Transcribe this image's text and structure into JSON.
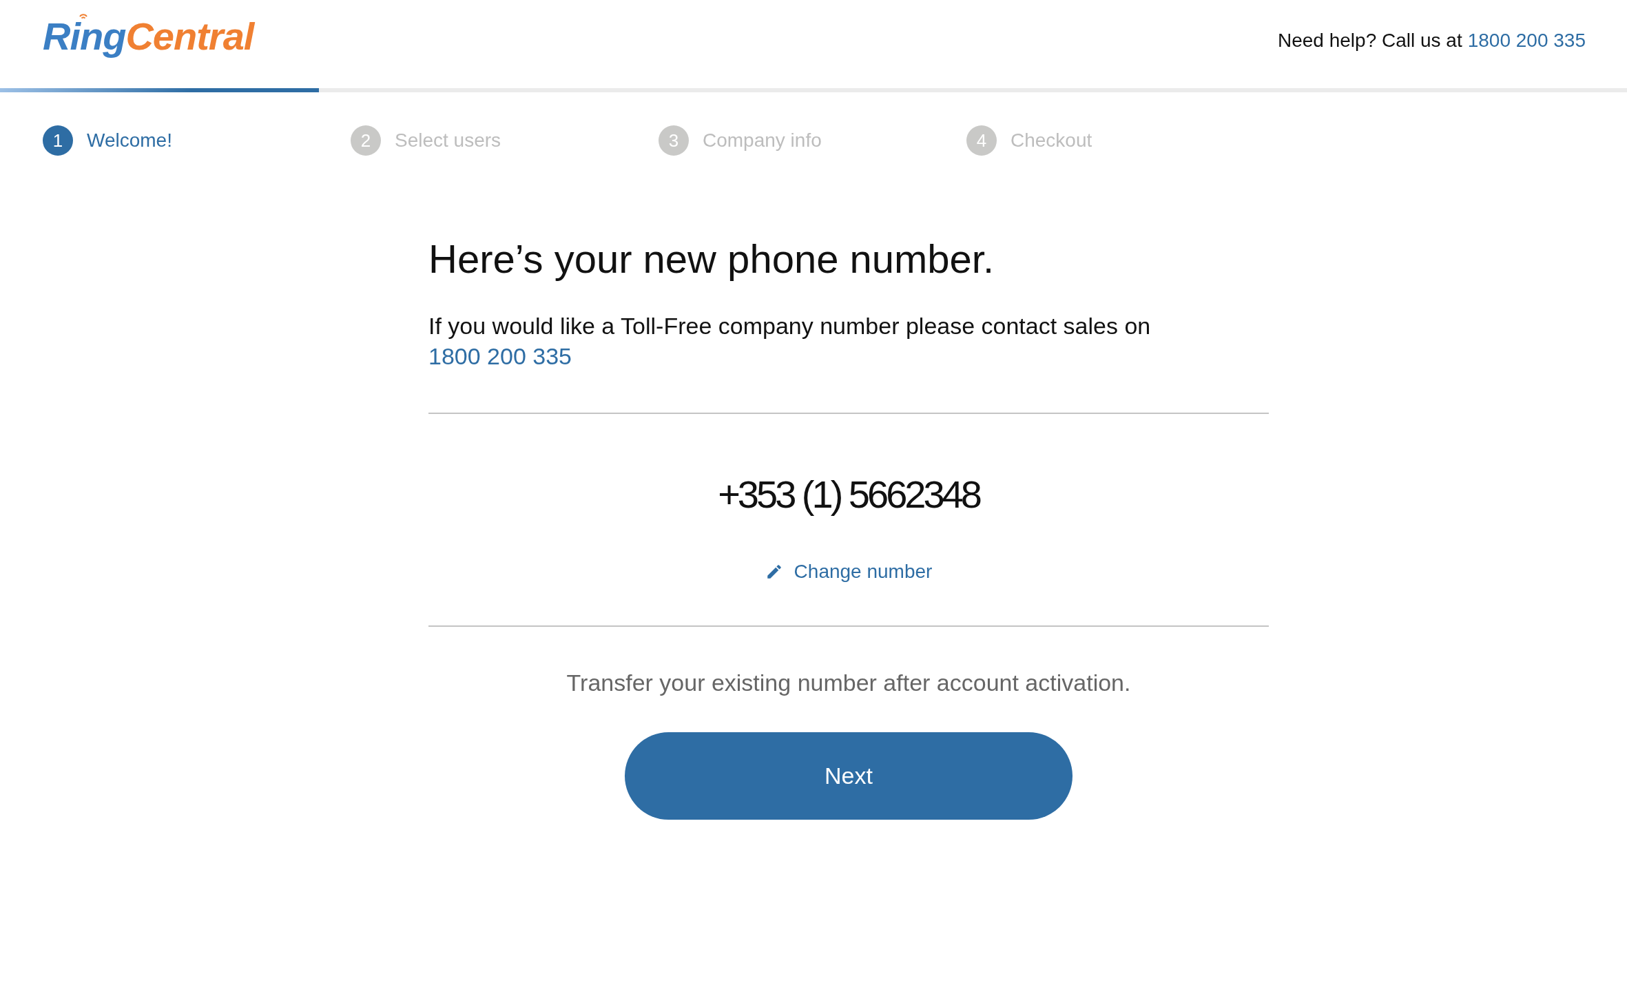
{
  "header": {
    "logo": {
      "primary": "Ring",
      "secondary": "Central"
    },
    "help_text": "Need help? Call us at",
    "help_phone": "1800 200 335"
  },
  "progress": {
    "level": 0.196
  },
  "steps": [
    {
      "number": "1",
      "label": "Welcome!",
      "selected": true
    },
    {
      "number": "2",
      "label": "Select users",
      "selected": false
    },
    {
      "number": "3",
      "label": "Company info",
      "selected": false
    },
    {
      "number": "4",
      "label": "Checkout",
      "selected": false
    }
  ],
  "content": {
    "heading": "Here’s your new phone number.",
    "intro": "If you would like a Toll-Free company number please contact sales on",
    "sales_phone": "1800 200 335",
    "phone_number": "+353 (1) 5662348",
    "change_link": "Change number",
    "transfer_note": "Transfer your existing number after account activation.",
    "next_button": "Next"
  }
}
